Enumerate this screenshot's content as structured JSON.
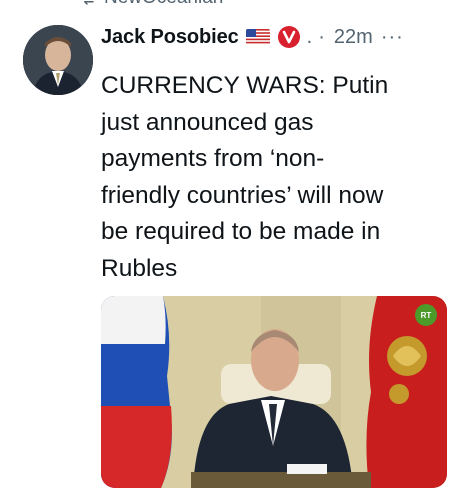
{
  "retweet": {
    "text": "NewOceanian",
    "icon": "retweet-icon"
  },
  "tweet": {
    "author": {
      "name": "Jack Posobiec",
      "badges": [
        "us-flag-icon",
        "v-badge-icon"
      ],
      "dot": ".",
      "separator": "·"
    },
    "timestamp": "22m",
    "more": "···",
    "text": "CURRENCY WARS: Putin just announced gas payments from ‘non-friendly countries’ will now be required to be made in Rubles",
    "text_lines": [
      "CURRENCY WARS: Putin",
      "just announced gas",
      "payments from ‘non-",
      "friendly countries’ will now",
      "be required to be made in",
      "Rubles"
    ],
    "media": {
      "type": "video-frame",
      "watermark": "RT",
      "colors": {
        "russian_flag_white": "#f3f3f3",
        "russian_flag_blue": "#1f4fb5",
        "russian_flag_red": "#d62828",
        "background_wall": "#d8cda3"
      }
    }
  },
  "colors": {
    "text_primary": "#0f1419",
    "text_secondary": "#536471",
    "badge_red": "#e0245e"
  }
}
